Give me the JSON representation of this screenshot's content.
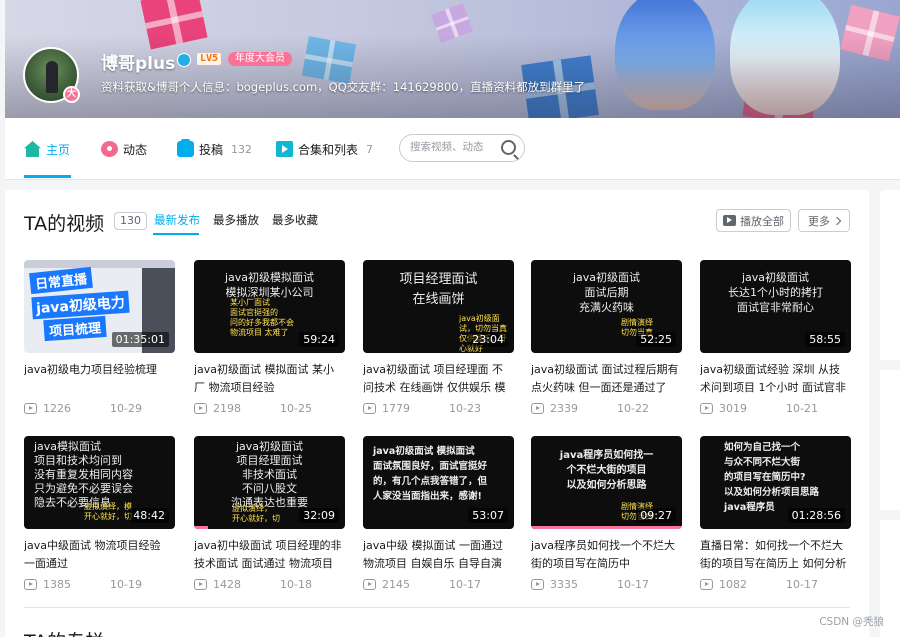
{
  "profile": {
    "name": "博哥plus",
    "level": "LV5",
    "vip_badge": "年度大会员",
    "avatar_badge": "大",
    "sign": "资料获取&博哥个人信息：bogeplus.com，QQ交友群：141629800，直播资料都放到群里了"
  },
  "nav": {
    "home": "主页",
    "dynamic": "动态",
    "uploads": "投稿",
    "uploads_count": "132",
    "collections": "合集和列表",
    "collections_count": "7",
    "search_placeholder": "搜索视频、动态"
  },
  "videos_section": {
    "title": "TA的视频",
    "count": "130",
    "sort_tabs": [
      "最新发布",
      "最多播放",
      "最多收藏"
    ],
    "play_all": "播放全部",
    "more": "更多"
  },
  "videos": [
    {
      "thumb_lines": [
        "日常直播",
        "java初级电力",
        "项目梳理"
      ],
      "duration": "01:35:01",
      "title": "java初级电力项目经验梳理",
      "views": "1226",
      "date": "10-29"
    },
    {
      "thumb_text": "java初级模拟面试\n模拟深圳某小公司",
      "thumb_accent": "某小厂面试\n面试官挺强的\n问的好多我都不会\n物流项目 太难了",
      "duration": "59:24",
      "title": "java初级面试 模拟面试 某小厂 物流项目经验",
      "views": "2198",
      "date": "10-25"
    },
    {
      "thumb_text": "项目经理面试\n在线画饼",
      "thumb_accent": "java初级面试，切勿当真\n仅供娱乐，开心就好",
      "duration": "23:04",
      "title": "java初级面试 项目经理面 不问技术 在线画饼 仅供娱乐 模",
      "views": "1779",
      "date": "10-23"
    },
    {
      "thumb_text": "java初级面试\n面试后期\n充满火药味",
      "thumb_accent": "剧情演绎\n切勿当真",
      "duration": "52:25",
      "title": "java初级面试 面试过程后期有点火药味 但一面还是通过了",
      "views": "2339",
      "date": "10-22"
    },
    {
      "thumb_text": "java初级面试\n长达1个小时的拷打\n面试官非常耐心",
      "thumb_accent": "",
      "duration": "58:55",
      "title": "java初级面试经验 深圳 从技术问到项目 1个小时 面试官非",
      "views": "3019",
      "date": "10-21"
    },
    {
      "thumb_text": "java模拟面试\n项目和技术均问到\n没有重复发相同内容\n只为避免不必要误会\n隐去不必要信息",
      "thumb_accent": "虚拟演绎，模\n开心就好，切",
      "duration": "48:42",
      "title": "java中级面试 物流项目经验 一面通过",
      "views": "1385",
      "date": "10-19"
    },
    {
      "thumb_text": "java初级面试\n项目经理面试\n非技术面试\n不问八股文\n沟通表达也重要",
      "thumb_accent": "虚拟演绎，\n开心就好，切",
      "duration": "32:09",
      "title": "java初中级面试 项目经理的非技术面试 面试通过 物流项目",
      "views": "1428",
      "date": "10-18"
    },
    {
      "thumb_text": "java初级面试 模拟面试\n面试氛围良好，面试官挺好\n的，有几个点我答错了，但\n人家没当面指出来，感谢!",
      "thumb_accent": "",
      "duration": "53:07",
      "title": "java中级 模拟面试 一面通过 物流项目 自娱自乐 自导自演",
      "views": "2145",
      "date": "10-17"
    },
    {
      "thumb_text": "java程序员如何找一\n个不烂大街的项目\n以及如何分析思路",
      "thumb_accent": "剧情演绎\n切勿当真",
      "duration": "09:27",
      "title": "java程序员如何找一个不烂大街的项目写在简历中",
      "views": "3335",
      "date": "10-17"
    },
    {
      "thumb_text": "如何为自己找一个\n与众不同不烂大街\n的项目写在简历中?\n以及如何分析项目思路\njava程序员",
      "thumb_accent": "",
      "duration": "01:28:56",
      "title": "直播日常：如何找一个不烂大街的项目写在简历上 如何分析",
      "views": "1082",
      "date": "10-17"
    }
  ],
  "second_section": {
    "title": "TA的专栏"
  },
  "watermark": "CSDN @秃狼",
  "colors": {
    "accent": "#00aeec",
    "pink": "#fb7299",
    "text": "#18191c",
    "muted": "#9499a0"
  }
}
